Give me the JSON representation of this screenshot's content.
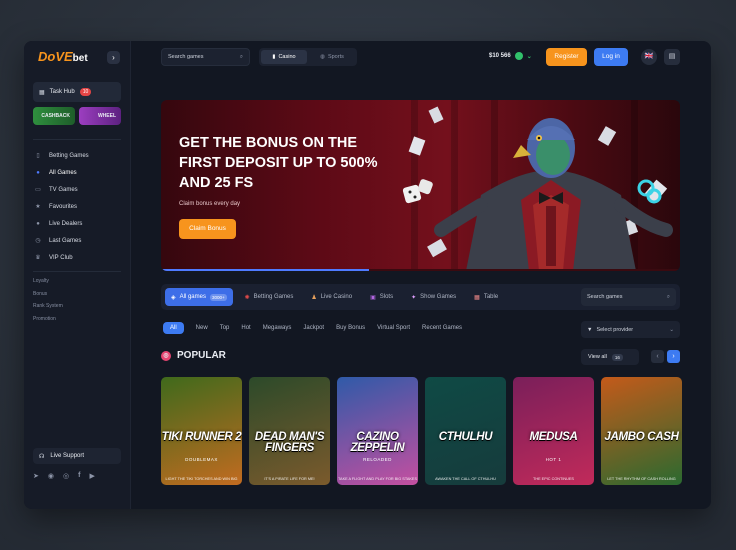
{
  "brand": {
    "logo_main": "DoVE",
    "logo_sub": "bet"
  },
  "sidebar": {
    "task_hub": {
      "label": "Task Hub",
      "count": "10"
    },
    "promos": [
      {
        "label": "CASHBACK"
      },
      {
        "label": "WHEEL"
      }
    ],
    "nav": [
      {
        "label": "Betting Games",
        "icon": "betting-icon"
      },
      {
        "label": "All Games",
        "icon": "dot-icon",
        "active": true
      },
      {
        "label": "TV Games",
        "icon": "tv-icon"
      },
      {
        "label": "Favourites",
        "icon": "star-icon"
      },
      {
        "label": "Live Dealers",
        "icon": "dot-icon"
      },
      {
        "label": "Last Games",
        "icon": "clock-icon"
      },
      {
        "label": "VIP Club",
        "icon": "crown-icon"
      }
    ],
    "links": [
      "Loyalty",
      "Bonus",
      "Rank System",
      "Promotion"
    ],
    "support": "Live Support"
  },
  "header": {
    "search_placeholder": "Search games",
    "modes": [
      {
        "label": "Casino",
        "active": true
      },
      {
        "label": "Sports"
      }
    ],
    "balance": "$10 566",
    "register": "Register",
    "login": "Log in"
  },
  "banner": {
    "title": "GET THE BONUS ON THE FIRST DEPOSIT UP TO 500% AND 25 FS",
    "subtitle": "Claim bonus every day",
    "button": "Claim Bonus",
    "progress": 0.4
  },
  "categories": {
    "items": [
      {
        "label": "All games",
        "count": "3000+",
        "active": true
      },
      {
        "label": "Betting Games"
      },
      {
        "label": "Live Casino"
      },
      {
        "label": "Slots"
      },
      {
        "label": "Show Games"
      },
      {
        "label": "Table"
      }
    ],
    "search_placeholder": "Search games"
  },
  "filters": {
    "items": [
      "All",
      "New",
      "Top",
      "Hot",
      "Megaways",
      "Jackpot",
      "Buy Bonus",
      "Virtual Sport",
      "Recent Games"
    ],
    "provider": "Select provider"
  },
  "popular": {
    "title": "POPULAR",
    "view_all": "View all",
    "count": "16",
    "games": [
      {
        "title": "TIKI RUNNER 2",
        "subtitle": "DOUBLEMAX",
        "tagline": "LIGHT THE TIKI TORCHES AND WIN BIG",
        "colors": [
          "#3f6a1c",
          "#c26b20"
        ]
      },
      {
        "title": "DEAD MAN'S FINGERS",
        "subtitle": "",
        "tagline": "IT'S A PIRATE LIFE FOR ME!",
        "colors": [
          "#2c4a2a",
          "#7b5a2c"
        ]
      },
      {
        "title": "CAZINO ZEPPELIN",
        "subtitle": "RELOADED",
        "tagline": "TAKE A FLIGHT AND PLAY FOR BIG STAKES",
        "colors": [
          "#2f5aa8",
          "#c44fa0"
        ]
      },
      {
        "title": "CTHULHU",
        "subtitle": "",
        "tagline": "AWAKEN THE CALL OF CTHULHU",
        "colors": [
          "#0f4a45",
          "#163b3c"
        ]
      },
      {
        "title": "MEDUSA",
        "subtitle": "HOT 1",
        "tagline": "THE EPIC CONTINUES",
        "colors": [
          "#7a1f5a",
          "#c12a5a"
        ]
      },
      {
        "title": "JAMBO CASH",
        "subtitle": "",
        "tagline": "LET THE RHYTHM OF CASH ROLLING",
        "colors": [
          "#c45a1a",
          "#2a6a30"
        ]
      }
    ]
  }
}
